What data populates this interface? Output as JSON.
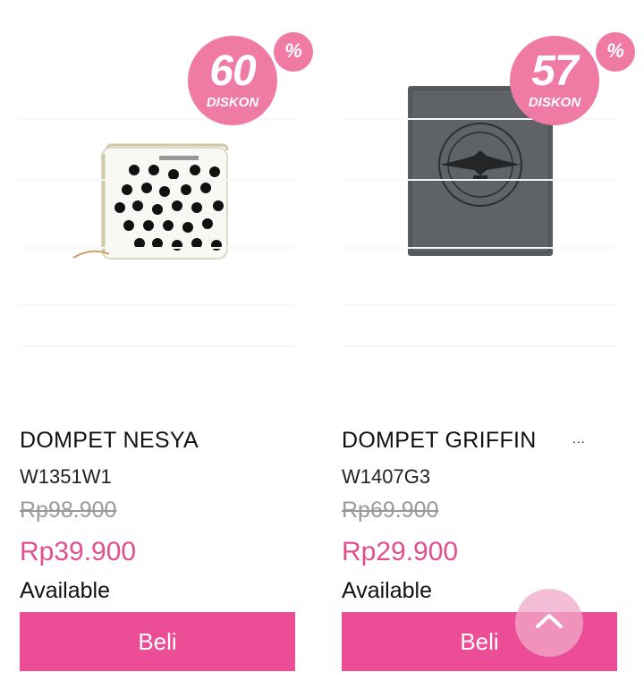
{
  "products": [
    {
      "discount_value": "60",
      "discount_label": "DISKON",
      "percent_symbol": "%",
      "name": "DOMPET NESYA",
      "more": "",
      "sku": "W1351W1",
      "original_price": "Rp98.900",
      "sale_price": "Rp39.900",
      "availability": "Available",
      "buy_label": "Beli",
      "image_icon": "polka-dot-wallet-icon"
    },
    {
      "discount_value": "57",
      "discount_label": "DISKON",
      "percent_symbol": "%",
      "name": "DOMPET GRIFFIN",
      "more": "...",
      "sku": "W1407G3",
      "original_price": "Rp69.900",
      "sale_price": "Rp29.900",
      "availability": "Available",
      "buy_label": "Beli",
      "image_icon": "grey-passport-wallet-icon"
    }
  ],
  "scroll_top_icon": "chevron-up-icon",
  "colors": {
    "badge": "#ef7aa4",
    "sale_price": "#e0508f",
    "button": "#ec4d97",
    "old_price": "#9a9a9a"
  }
}
